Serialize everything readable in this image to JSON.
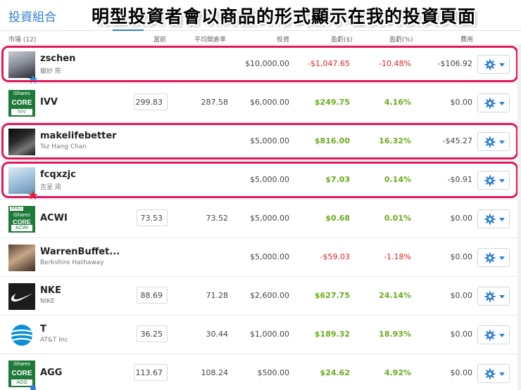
{
  "tabs": {
    "active": "投資組合"
  },
  "banner": "明型投資者會以商品的形式顯示在我的投資頁面",
  "columns": {
    "market": "市場 (12)",
    "current": "當前",
    "avg_open": "平均開倉率",
    "invested": "投資",
    "pl_amount": "盈虧($)",
    "pl_percent": "盈虧(%)",
    "fees": "費用"
  },
  "rows": [
    {
      "name": "zschen",
      "sub": "銀妙 陈",
      "current": "",
      "avg_open": "",
      "invested": "$10,000.00",
      "pl": "-$1,047.65",
      "pl_pct": "-10.48%",
      "fee": "-$106.92",
      "pl_sign": "neg",
      "avatar": "person-photo",
      "badge": "blue-star-icon",
      "highlighted": true
    },
    {
      "name": "IVV",
      "sub": "",
      "current": "299.83",
      "avg_open": "287.58",
      "invested": "$6,000.00",
      "pl": "$249.75",
      "pl_pct": "4.16%",
      "fee": "$0.00",
      "pl_sign": "pos",
      "avatar": "ishares-core-logo",
      "logo_top": "iShares",
      "logo_core": "CORE",
      "logo_sub": "IVV",
      "highlighted": false
    },
    {
      "name": "makelifebetter",
      "sub": "Tsz Hang Chan",
      "current": "",
      "avg_open": "",
      "invested": "$5,000.00",
      "pl": "$816.00",
      "pl_pct": "16.32%",
      "fee": "-$45.27",
      "pl_sign": "pos",
      "avatar": "person-photo",
      "highlighted": true
    },
    {
      "name": "fcqxzjc",
      "sub": "吉呈 周",
      "current": "",
      "avg_open": "",
      "invested": "$5,000.00",
      "pl": "$7.03",
      "pl_pct": "0.14%",
      "fee": "-$0.91",
      "pl_sign": "pos",
      "avatar": "person-photo",
      "badge": "red-star-icon",
      "highlighted": true
    },
    {
      "name": "ACWI",
      "sub": "",
      "current": "73.53",
      "avg_open": "73.52",
      "invested": "$5,000.00",
      "pl": "$0.68",
      "pl_pct": "0.01%",
      "fee": "$0.00",
      "pl_sign": "pos",
      "avatar": "ishares-msci-logo",
      "logo_msci": "MSCI",
      "logo_top": "iShares",
      "logo_core": "CORE",
      "logo_sub": "ACWI",
      "highlighted": false
    },
    {
      "name": "WarrenBuffet...",
      "sub": "Berkshire Hathaway",
      "current": "",
      "avg_open": "",
      "invested": "$5,000.00",
      "pl": "-$59.03",
      "pl_pct": "-1.18%",
      "fee": "$0.00",
      "pl_sign": "neg",
      "avatar": "person-photo",
      "highlighted": false
    },
    {
      "name": "NKE",
      "sub": "NIKE",
      "current": "88.69",
      "avg_open": "71.28",
      "invested": "$2,600.00",
      "pl": "$627.75",
      "pl_pct": "24.14%",
      "fee": "$0.00",
      "pl_sign": "pos",
      "avatar": "nike-logo",
      "highlighted": false
    },
    {
      "name": "T",
      "sub": "AT&T Inc",
      "current": "36.25",
      "avg_open": "30.44",
      "invested": "$1,000.00",
      "pl": "$189.32",
      "pl_pct": "18.93%",
      "fee": "$0.00",
      "pl_sign": "pos",
      "avatar": "att-logo",
      "highlighted": false
    },
    {
      "name": "AGG",
      "sub": "",
      "current": "113.67",
      "avg_open": "108.24",
      "invested": "$500.00",
      "pl": "$24.62",
      "pl_pct": "4.92%",
      "fee": "$0.00",
      "pl_sign": "pos",
      "avatar": "ishares-core-logo",
      "logo_top": "iShares",
      "logo_core": "CORE",
      "logo_sub": "AGG",
      "badge": "bell-icon",
      "highlighted": false
    }
  ],
  "colors": {
    "accent": "#2d7fd3",
    "positive": "#6aaa1d",
    "negative": "#e0252c",
    "highlight": "#e0185c",
    "ishares_green": "#1f7a3a"
  }
}
